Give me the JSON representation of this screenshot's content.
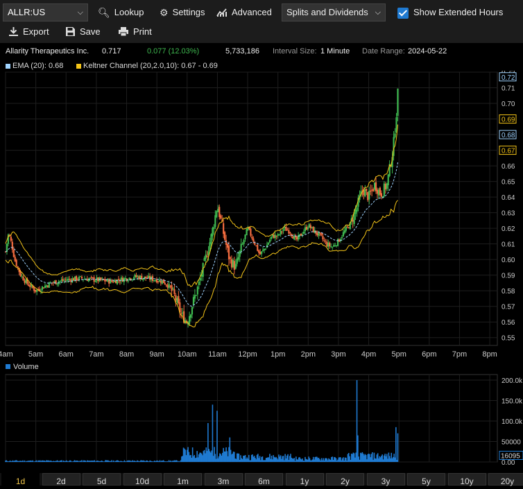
{
  "toolbar": {
    "symbol": "ALLR:US",
    "lookup": "Lookup",
    "settings": "Settings",
    "advanced": "Advanced",
    "splits": "Splits and Dividends",
    "extended_hours": "Show Extended Hours",
    "extended_checked": true,
    "export": "Export",
    "save": "Save",
    "print": "Print"
  },
  "info": {
    "company": "Allarity Therapeutics Inc.",
    "price": "0.717",
    "change": "0.077 (12.03%)",
    "volume": "5,733,186",
    "interval_label": "Interval Size:",
    "interval_value": "1 Minute",
    "range_label": "Date Range:",
    "range_value": "2024-05-22"
  },
  "legend": {
    "ema": "EMA (20): 0.68",
    "keltner": "Keltner Channel (20,2.0,10): 0.67 - 0.69",
    "volume": "Volume"
  },
  "colors": {
    "up": "#3fb950",
    "down": "#f36c3f",
    "ema": "#9fd3ff",
    "keltner": "#f5c518",
    "volume": "#1f7ad1",
    "active_period": "#f3c84b"
  },
  "chart_data": [
    {
      "type": "candlestick",
      "title": "",
      "x_ticks": [
        "4am",
        "5am",
        "6am",
        "7am",
        "8am",
        "9am",
        "10am",
        "11am",
        "12pm",
        "1pm",
        "2pm",
        "3pm",
        "4pm",
        "5pm",
        "6pm",
        "7pm",
        "8pm"
      ],
      "y_ticks": [
        "0.55",
        "0.56",
        "0.57",
        "0.58",
        "0.59",
        "0.60",
        "0.61",
        "0.62",
        "0.63",
        "0.64",
        "0.65",
        "0.66",
        "0.67",
        "0.68",
        "0.69",
        "0.70",
        "0.71",
        "0.72"
      ],
      "ylim": [
        0.545,
        0.72
      ],
      "price_tags": [
        {
          "label": "0.72",
          "value": 0.717,
          "color": "#9fd3ff"
        },
        {
          "label": "0.69",
          "value": 0.69,
          "color": "#f5c518"
        },
        {
          "label": "0.68",
          "value": 0.68,
          "color": "#9fd3ff"
        },
        {
          "label": "0.67",
          "value": 0.67,
          "color": "#f5c518"
        }
      ],
      "close_series": {
        "x_hours": [
          4.0,
          4.1,
          4.2,
          4.3,
          4.5,
          4.7,
          5.0,
          5.2,
          5.5,
          6.0,
          6.5,
          7.0,
          7.5,
          8.0,
          8.3,
          8.7,
          9.0,
          9.2,
          9.4,
          9.6,
          9.8,
          10.0,
          10.2,
          10.4,
          10.6,
          10.8,
          11.0,
          11.2,
          11.4,
          11.6,
          11.8,
          12.0,
          12.2,
          12.4,
          12.6,
          12.8,
          13.0,
          13.2,
          13.4,
          13.6,
          13.8,
          14.0,
          14.2,
          14.4,
          14.6,
          14.8,
          15.0,
          15.2,
          15.4,
          15.6,
          15.8,
          16.0,
          16.2,
          16.4,
          16.6,
          16.8,
          16.9,
          17.0
        ],
        "values": [
          0.605,
          0.617,
          0.61,
          0.6,
          0.59,
          0.585,
          0.58,
          0.582,
          0.585,
          0.587,
          0.588,
          0.587,
          0.586,
          0.588,
          0.589,
          0.588,
          0.587,
          0.586,
          0.583,
          0.576,
          0.565,
          0.56,
          0.573,
          0.585,
          0.6,
          0.615,
          0.635,
          0.617,
          0.6,
          0.595,
          0.608,
          0.62,
          0.612,
          0.603,
          0.608,
          0.615,
          0.615,
          0.62,
          0.618,
          0.612,
          0.617,
          0.622,
          0.618,
          0.615,
          0.61,
          0.608,
          0.612,
          0.618,
          0.623,
          0.633,
          0.645,
          0.64,
          0.648,
          0.642,
          0.648,
          0.67,
          0.69,
          0.717
        ]
      }
    },
    {
      "type": "bar",
      "title": "Volume",
      "y_ticks": [
        "0.00",
        "50000",
        "100.0k",
        "150.0k",
        "200.0k"
      ],
      "ylim": [
        0,
        200000
      ],
      "last_value": "16095",
      "peaks": [
        {
          "x_hours": 10.7,
          "value": 95000
        },
        {
          "x_hours": 10.85,
          "value": 140000
        },
        {
          "x_hours": 11.0,
          "value": 125000
        },
        {
          "x_hours": 11.4,
          "value": 60000
        },
        {
          "x_hours": 15.6,
          "value": 200000
        },
        {
          "x_hours": 15.65,
          "value": 65000
        },
        {
          "x_hours": 16.9,
          "value": 85000
        },
        {
          "x_hours": 16.95,
          "value": 70000
        }
      ]
    }
  ],
  "periods": [
    "1d",
    "2d",
    "5d",
    "10d",
    "1m",
    "3m",
    "6m",
    "1y",
    "2y",
    "3y",
    "5y",
    "10y",
    "20y"
  ],
  "active_period": "1d"
}
